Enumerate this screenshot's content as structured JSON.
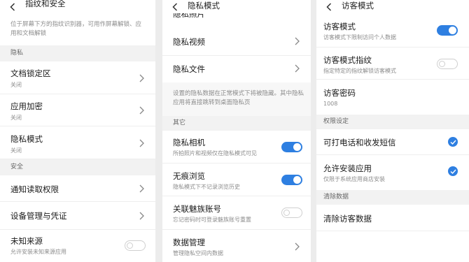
{
  "panel1": {
    "title": "指纹和安全",
    "intro": "位于屏幕下方的指纹识别器，可用作屏幕解锁、应用和文档解锁",
    "section_privacy": "隐私",
    "doc_lock": {
      "title": "文档锁定区",
      "sub": "关闭"
    },
    "app_encrypt": {
      "title": "应用加密",
      "sub": "关闭"
    },
    "privacy_mode": {
      "title": "隐私模式",
      "sub": "关闭"
    },
    "section_security": "安全",
    "notification": {
      "title": "通知读取权限"
    },
    "device_mgmt": {
      "title": "设备管理与凭证"
    },
    "unknown_source": {
      "title": "未知来源",
      "sub": "允许安装未知来源应用",
      "toggle": "off"
    }
  },
  "panel2": {
    "title": "隐私模式",
    "photo_partial": "隐私照片",
    "video": {
      "title": "隐私视频"
    },
    "file": {
      "title": "隐私文件"
    },
    "note": "设置的隐私数据在正常模式下将被隐藏。其中隐私应用将直接跳转到桌面隐私页",
    "section_other": "其它",
    "camera": {
      "title": "隐私相机",
      "sub": "所拍照片和视频仅在隐私模式可见",
      "toggle": "on"
    },
    "traceless": {
      "title": "无痕浏览",
      "sub": "隐私模式下不记录浏览历史",
      "toggle": "on"
    },
    "meizu_link": {
      "title": "关联魅族账号",
      "sub": "忘记密码时可登录魅族账号重置",
      "toggle": "off"
    },
    "data_mgmt": {
      "title": "数据管理",
      "sub": "管理隐私空间内数据"
    }
  },
  "panel3": {
    "title": "访客模式",
    "guest_mode": {
      "title": "访客模式",
      "sub": "访客模式下限制访问个人数据",
      "toggle": "on"
    },
    "guest_fingerprint": {
      "title": "访客模式指纹",
      "sub": "指定特定的指纹解锁访客模式",
      "toggle": "off"
    },
    "guest_password": {
      "title": "访客密码",
      "sub": "1008"
    },
    "section_permissions": "权限设定",
    "calls_sms": {
      "title": "可打电话和收发短信",
      "checked": true
    },
    "install_apps": {
      "title": "允许安装应用",
      "sub": "仅限于系统应用商店安装",
      "checked": true
    },
    "section_clear": "清除数据",
    "clear_data": {
      "title": "清除访客数据"
    }
  },
  "colors": {
    "accent": "#2e7fe1",
    "section_bg": "#f2f2f2",
    "subtext": "#8c8c8c"
  }
}
